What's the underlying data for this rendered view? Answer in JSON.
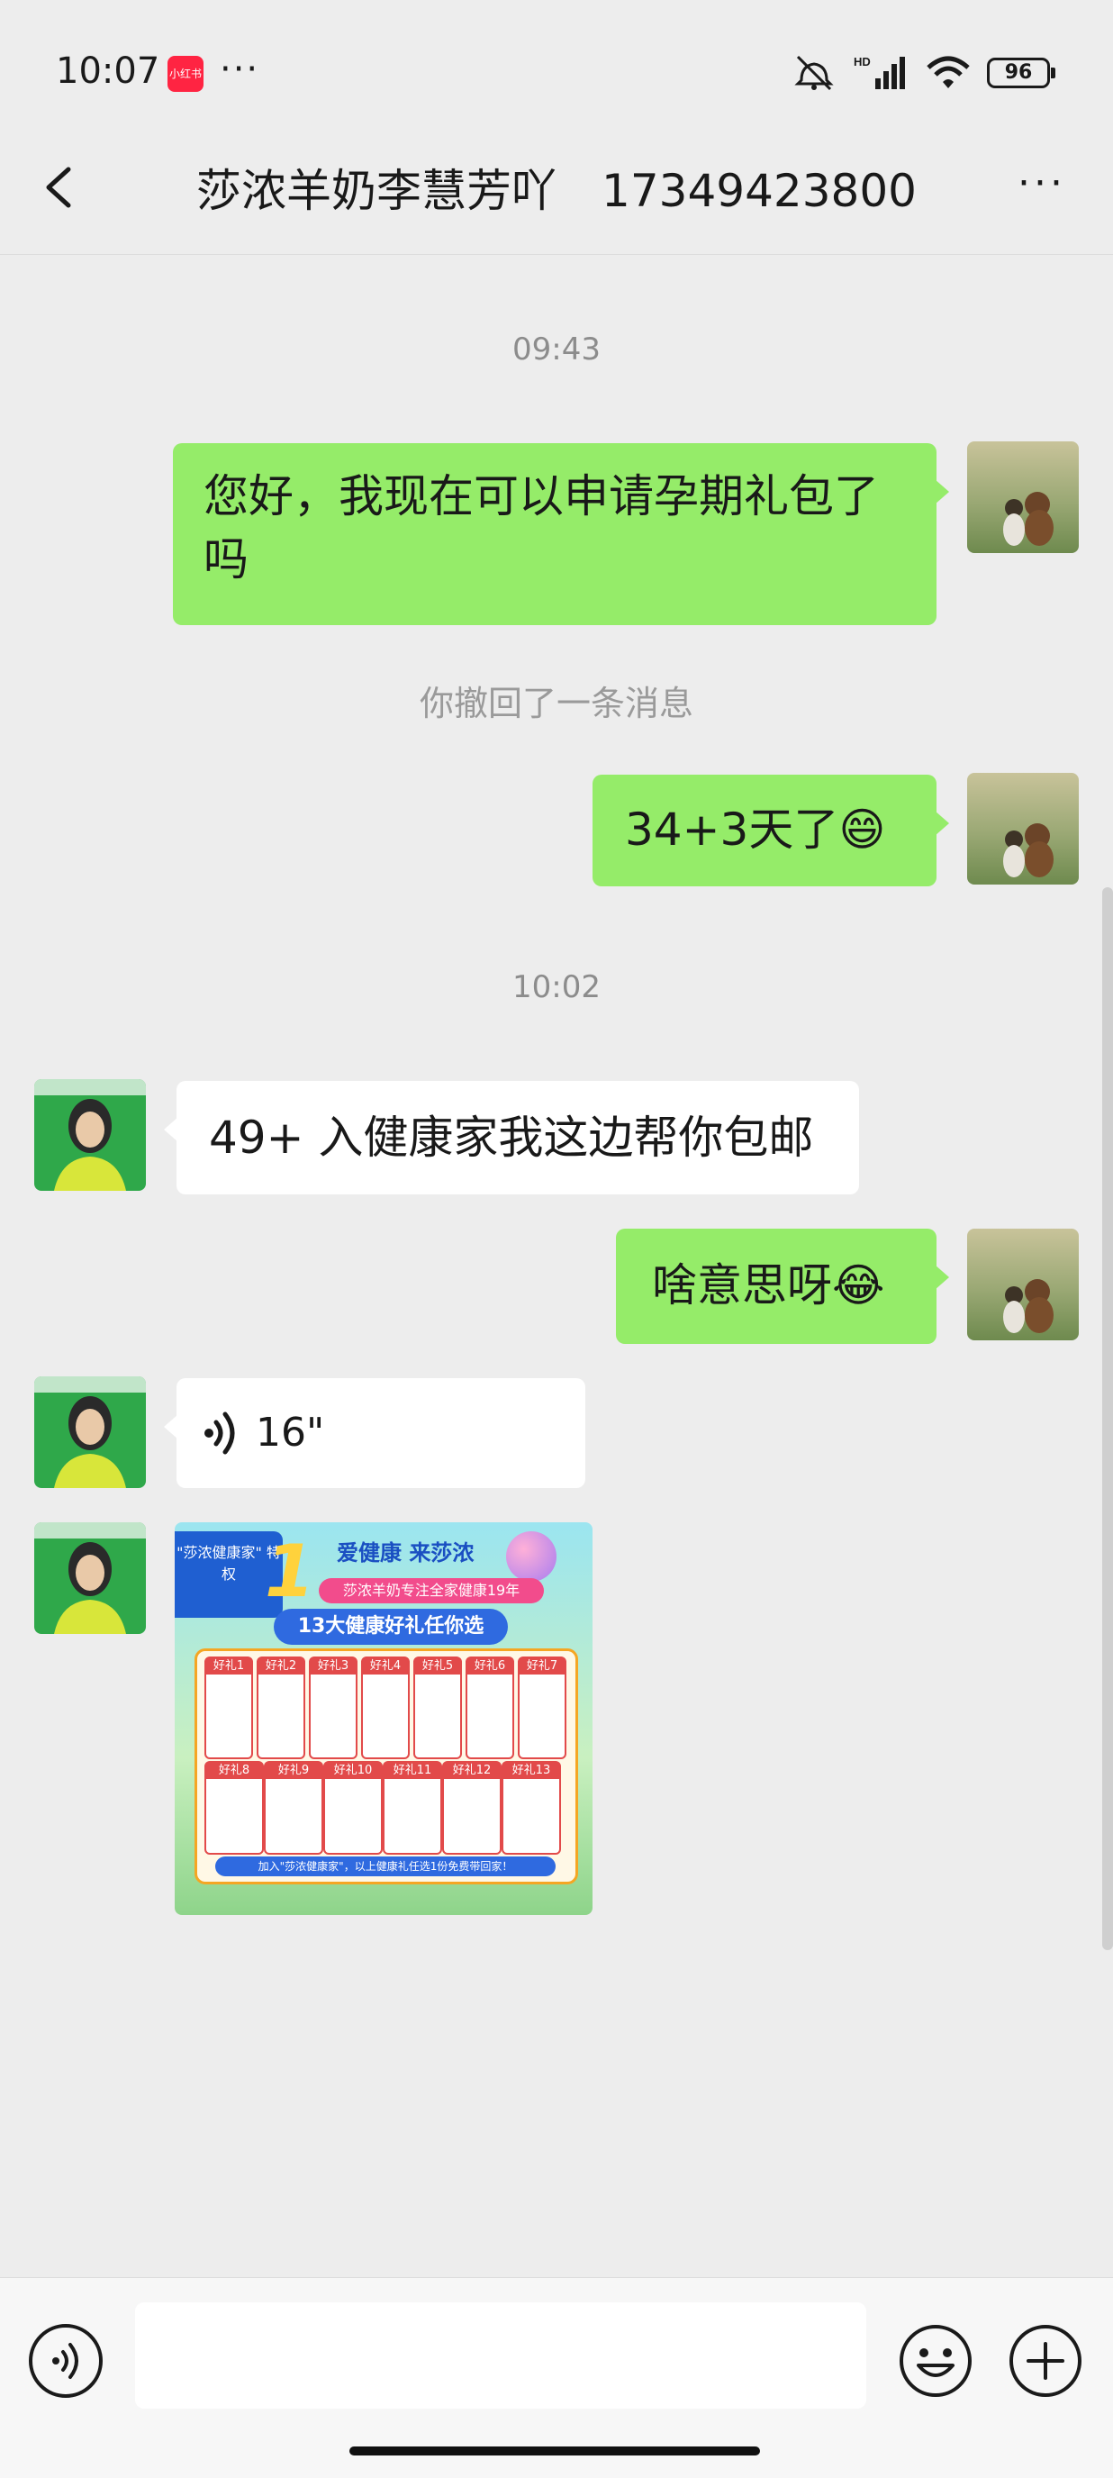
{
  "status_bar": {
    "time": "10:07",
    "app_badge": "小红书",
    "dots": "···",
    "battery": "96",
    "icons": [
      "mute-icon",
      "hd-icon",
      "signal-icon",
      "wifi-icon",
      "battery-icon"
    ]
  },
  "header": {
    "title": "莎浓羊奶李慧芳吖　17349423800",
    "more": "···"
  },
  "messages": {
    "time1": "09:43",
    "msg1": "您好，我现在可以申请孕期礼包了吗",
    "recalled": "你撤回了一条消息",
    "msg2": "34+3天了",
    "msg2_emoji": "😄",
    "time2": "10:02",
    "msg3": "49+ 入健康家我这边帮你包邮",
    "msg4": "啥意思呀",
    "msg4_emoji": "😂",
    "voice_duration": "16\""
  },
  "promo": {
    "privilege_tag": "\"莎浓健康家\" 特权",
    "privilege_number": "1",
    "slogan": "爱健康 来莎浓",
    "subtitle": "莎浓羊奶专注全家健康19年",
    "headline": "13大健康好礼任你选",
    "gifts": [
      "好礼1",
      "好礼2",
      "好礼3",
      "好礼4",
      "好礼5",
      "好礼6",
      "好礼7",
      "好礼8",
      "好礼9",
      "好礼10",
      "好礼11",
      "好礼12",
      "好礼13"
    ],
    "footer": "加入\"莎浓健康家\"，以上健康礼任选1份免费带回家！"
  },
  "input_bar": {
    "placeholder": ""
  },
  "colors": {
    "background": "#ededed",
    "my_bubble": "#95ec69",
    "other_bubble": "#ffffff",
    "time_text": "#8c8c8c"
  }
}
